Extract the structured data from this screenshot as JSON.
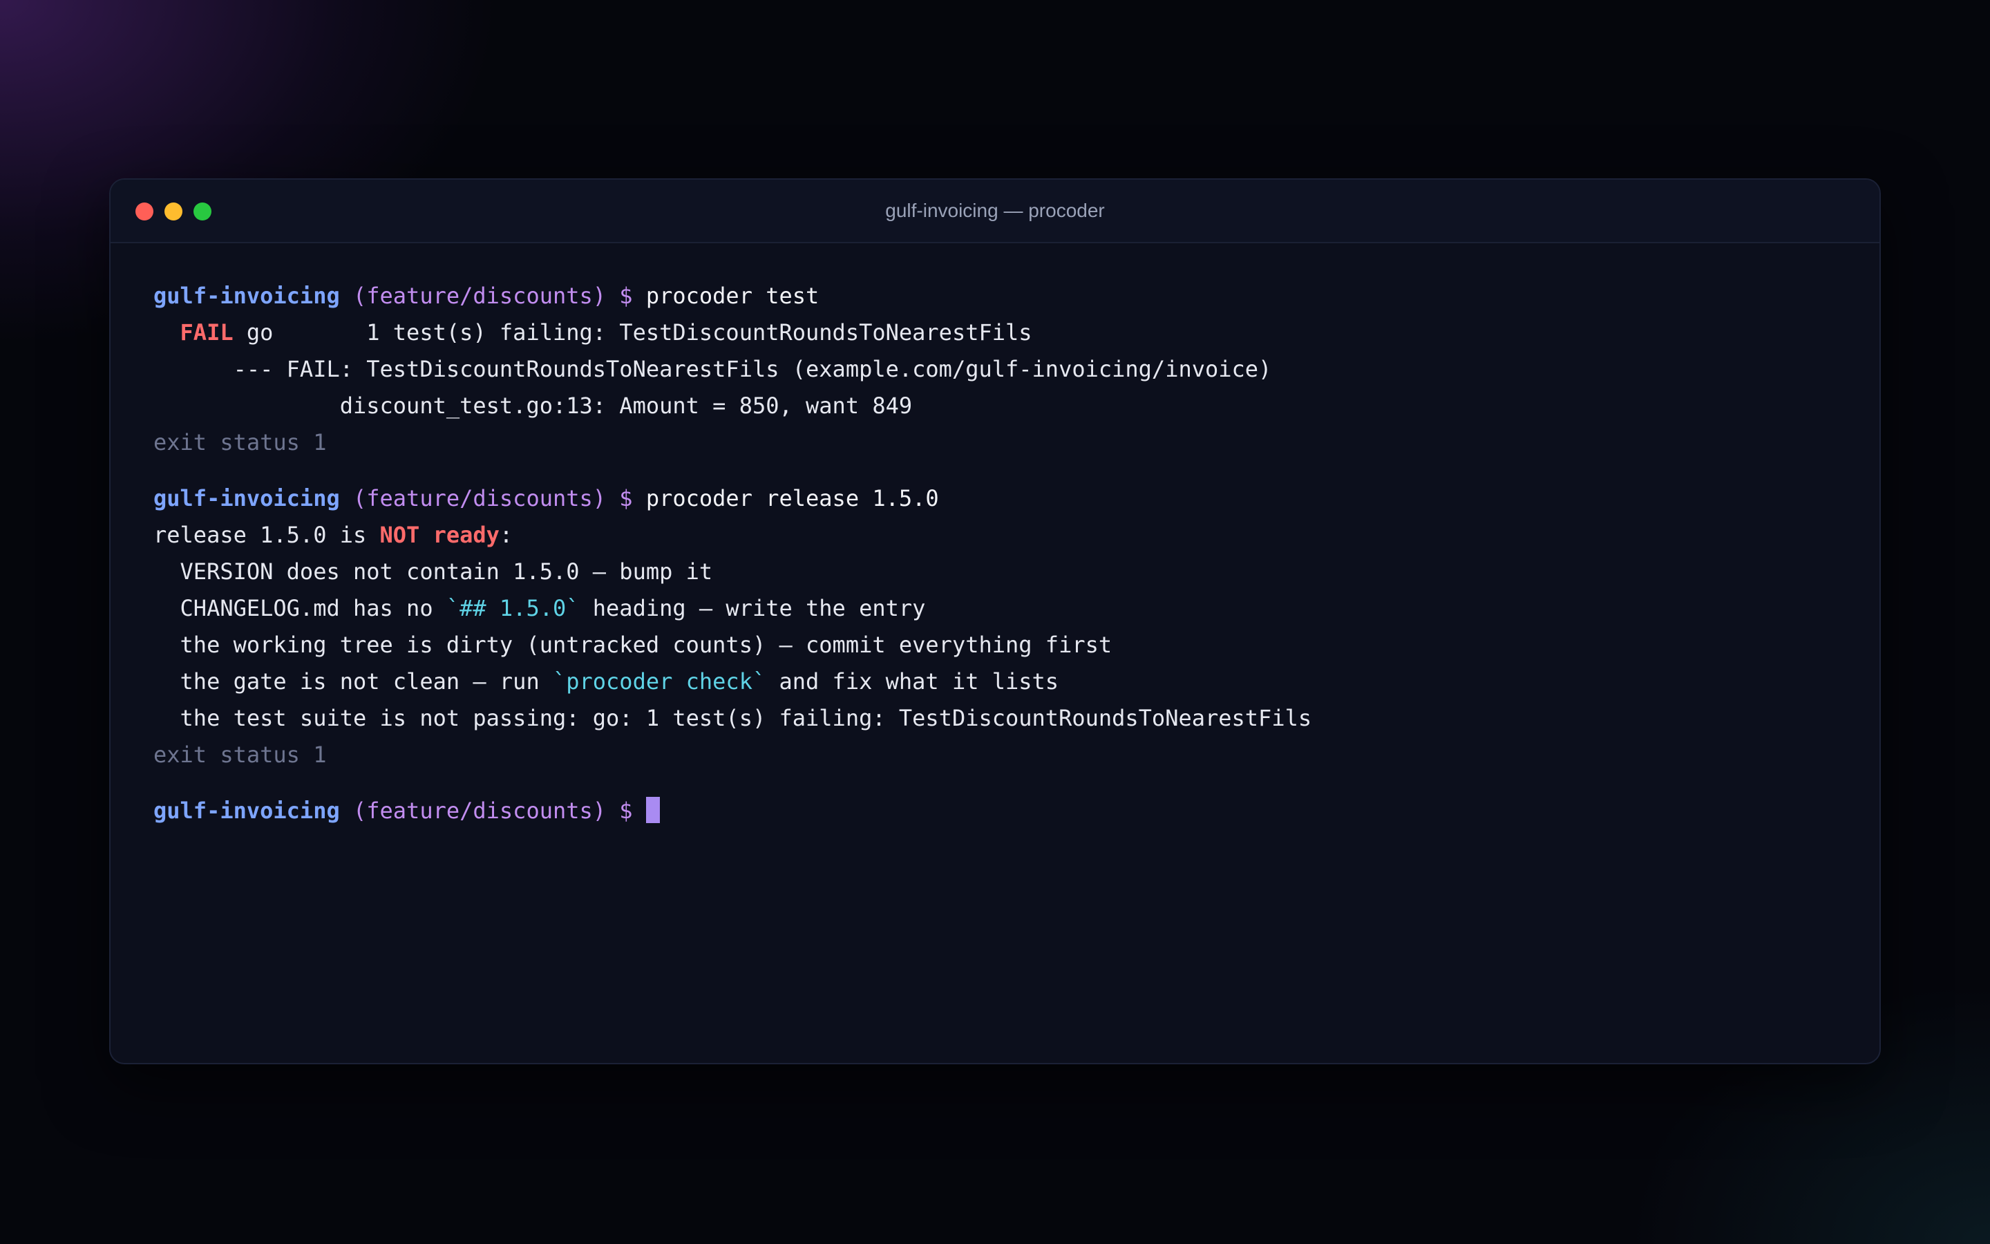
{
  "window": {
    "title": "gulf-invoicing — procoder"
  },
  "prompt": {
    "dir": "gulf-invoicing",
    "branch": "(feature/discounts)",
    "symbol": "$"
  },
  "block1": {
    "command": "procoder test",
    "fail_label": "FAIL",
    "fail_rest": " go       1 test(s) failing: TestDiscountRoundsToNearestFils",
    "detail": "      --- FAIL: TestDiscountRoundsToNearestFils (example.com/gulf-invoicing/invoice)",
    "location": "              discount_test.go:13: Amount = 850, want 849",
    "exit": "exit status 1"
  },
  "block2": {
    "command": "procoder release 1.5.0",
    "status_prefix": "release 1.5.0 is ",
    "status_flag": "NOT ready",
    "status_suffix": ":",
    "item_version": "  VERSION does not contain 1.5.0 — bump it",
    "item_changelog_pre": "  CHANGELOG.md has no ",
    "item_changelog_code": "`## 1.5.0`",
    "item_changelog_post": " heading — write the entry",
    "item_tree": "  the working tree is dirty (untracked counts) — commit everything first",
    "item_gate_pre": "  the gate is not clean — run ",
    "item_gate_code": "`procoder check`",
    "item_gate_post": " and fix what it lists",
    "item_tests": "  the test suite is not passing: go: 1 test(s) failing: TestDiscountRoundsToNearestFils",
    "exit": "exit status 1"
  },
  "colors": {
    "prompt_dir": "#7ea5ff",
    "prompt_branch": "#c28df0",
    "error": "#ff6b6b",
    "code": "#5fd3e6",
    "cursor": "#a98bf2"
  }
}
